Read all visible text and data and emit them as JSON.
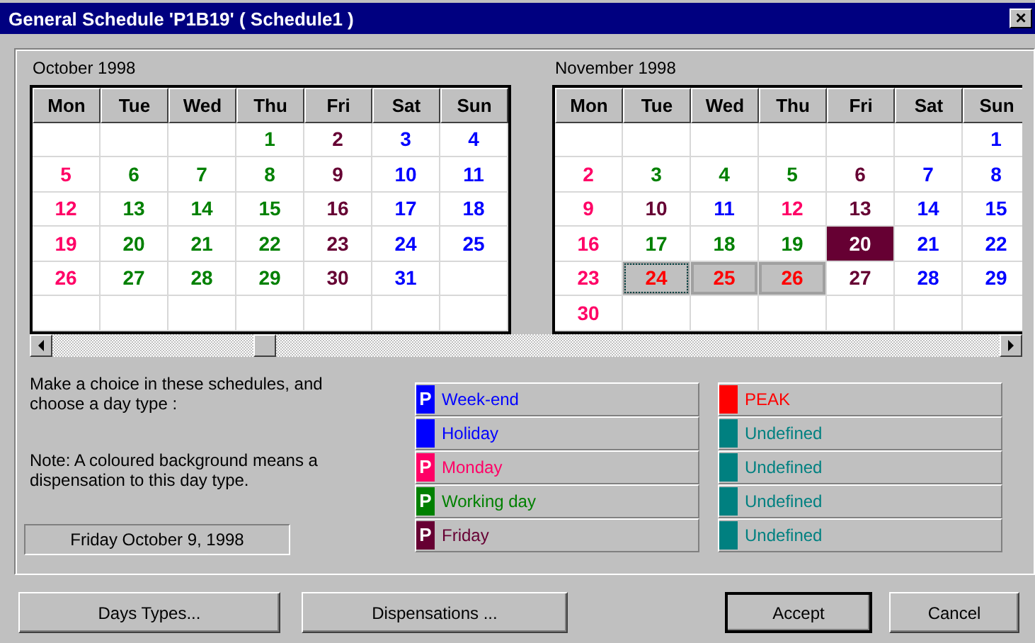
{
  "window": {
    "title": "General Schedule 'P1B19' ( Schedule1 )",
    "close": "×"
  },
  "calendars": [
    {
      "title": "October 1998",
      "weekdays": [
        "Mon",
        "Tue",
        "Wed",
        "Thu",
        "Fri",
        "Sat",
        "Sun"
      ],
      "weeks": [
        [
          {
            "day": "1",
            "color": "#008000",
            "selected": false
          },
          {
            "day": "2",
            "color": "#660033",
            "selected": false
          },
          {
            "day": "3",
            "color": "#0000ff",
            "selected": false
          },
          {
            "day": "4",
            "color": "#0000ff",
            "selected": false
          }
        ],
        [
          {
            "day": "5",
            "color": "#ff0066",
            "selected": false
          },
          {
            "day": "6",
            "color": "#008000",
            "selected": false
          },
          {
            "day": "7",
            "color": "#008000",
            "selected": false
          },
          {
            "day": "8",
            "color": "#008000",
            "selected": false
          },
          {
            "day": "9",
            "color": "#660033",
            "selected": false
          },
          {
            "day": "10",
            "color": "#0000ff",
            "selected": false
          },
          {
            "day": "11",
            "color": "#0000ff",
            "selected": false
          }
        ],
        [
          {
            "day": "12",
            "color": "#ff0066",
            "selected": false
          },
          {
            "day": "13",
            "color": "#008000",
            "selected": false
          },
          {
            "day": "14",
            "color": "#008000",
            "selected": false
          },
          {
            "day": "15",
            "color": "#008000",
            "selected": false
          },
          {
            "day": "16",
            "color": "#660033",
            "selected": false
          },
          {
            "day": "17",
            "color": "#0000ff",
            "selected": false
          },
          {
            "day": "18",
            "color": "#0000ff",
            "selected": false
          }
        ],
        [
          {
            "day": "19",
            "color": "#ff0066",
            "selected": false
          },
          {
            "day": "20",
            "color": "#008000",
            "selected": false
          },
          {
            "day": "21",
            "color": "#008000",
            "selected": false
          },
          {
            "day": "22",
            "color": "#008000",
            "selected": false
          },
          {
            "day": "23",
            "color": "#660033",
            "selected": false
          },
          {
            "day": "24",
            "color": "#0000ff",
            "selected": false
          },
          {
            "day": "25",
            "color": "#0000ff",
            "selected": false
          }
        ],
        [
          {
            "day": "26",
            "color": "#ff0066",
            "selected": false
          },
          {
            "day": "27",
            "color": "#008000",
            "selected": false
          },
          {
            "day": "28",
            "color": "#008000",
            "selected": false
          },
          {
            "day": "29",
            "color": "#008000",
            "selected": false
          },
          {
            "day": "30",
            "color": "#660033",
            "selected": false
          },
          {
            "day": "31",
            "color": "#0000ff",
            "selected": false
          }
        ]
      ]
    },
    {
      "title": "November 1998",
      "weekdays": [
        "Mon",
        "Tue",
        "Wed",
        "Thu",
        "Fri",
        "Sat",
        "Sun"
      ],
      "weeks": [
        [
          {
            "day": "1",
            "color": "#0000ff",
            "selected": false
          }
        ],
        [
          {
            "day": "2",
            "color": "#ff0066",
            "selected": false
          },
          {
            "day": "3",
            "color": "#008000",
            "selected": false
          },
          {
            "day": "4",
            "color": "#008000",
            "selected": false
          },
          {
            "day": "5",
            "color": "#008000",
            "selected": false
          },
          {
            "day": "6",
            "color": "#660033",
            "selected": false
          },
          {
            "day": "7",
            "color": "#0000ff",
            "selected": false
          },
          {
            "day": "8",
            "color": "#0000ff",
            "selected": false
          }
        ],
        [
          {
            "day": "9",
            "color": "#ff0066",
            "selected": false
          },
          {
            "day": "10",
            "color": "#660033",
            "selected": false
          },
          {
            "day": "11",
            "color": "#0000ff",
            "selected": false
          },
          {
            "day": "12",
            "color": "#ff0066",
            "selected": false
          },
          {
            "day": "13",
            "color": "#660033",
            "selected": false
          },
          {
            "day": "14",
            "color": "#0000ff",
            "selected": false
          },
          {
            "day": "15",
            "color": "#0000ff",
            "selected": false
          }
        ],
        [
          {
            "day": "16",
            "color": "#ff0066",
            "selected": false
          },
          {
            "day": "17",
            "color": "#008000",
            "selected": false
          },
          {
            "day": "18",
            "color": "#008000",
            "selected": false
          },
          {
            "day": "19",
            "color": "#008000",
            "selected": false
          },
          {
            "day": "20",
            "color": "#660033",
            "selected": false,
            "dispensation": true
          },
          {
            "day": "21",
            "color": "#0000ff",
            "selected": false
          },
          {
            "day": "22",
            "color": "#0000ff",
            "selected": false
          }
        ],
        [
          {
            "day": "23",
            "color": "#ff0066",
            "selected": false
          },
          {
            "day": "24",
            "color": "#ff0000",
            "selected": true,
            "focused": true
          },
          {
            "day": "25",
            "color": "#ff0000",
            "selected": true
          },
          {
            "day": "26",
            "color": "#ff0000",
            "selected": true
          },
          {
            "day": "27",
            "color": "#660033",
            "selected": false
          },
          {
            "day": "28",
            "color": "#0000ff",
            "selected": false
          },
          {
            "day": "29",
            "color": "#0000ff",
            "selected": false
          }
        ],
        [
          {
            "day": "30",
            "color": "#ff0066",
            "selected": false
          }
        ]
      ]
    }
  ],
  "instructions": "Make a choice in these schedules, and choose a day type :",
  "note": "Note: A coloured background means a dispensation to this day type.",
  "current_date": "Friday October 9, 1998",
  "day_types": [
    [
      {
        "label": "Week-end",
        "color": "#0000ff",
        "marker": "P"
      },
      {
        "label": "Holiday",
        "color": "#0000ff"
      },
      {
        "label": "Monday",
        "color": "#ff0066",
        "marker": "P"
      },
      {
        "label": "Working day",
        "color": "#008000",
        "marker": "P"
      },
      {
        "label": "Friday",
        "color": "#660033",
        "marker": "P"
      }
    ],
    [
      {
        "label": "PEAK",
        "color": "#ff0000"
      },
      {
        "label": "Undefined",
        "color": "#008080"
      },
      {
        "label": "Undefined",
        "color": "#008080"
      },
      {
        "label": "Undefined",
        "color": "#008080"
      },
      {
        "label": "Undefined",
        "color": "#008080"
      }
    ]
  ],
  "buttons": [
    {
      "label": "Days Types...",
      "default": false
    },
    {
      "label": "Dispensations ...",
      "default": false
    },
    {
      "label": "Accept",
      "default": true
    },
    {
      "label": "Cancel",
      "default": false
    }
  ]
}
